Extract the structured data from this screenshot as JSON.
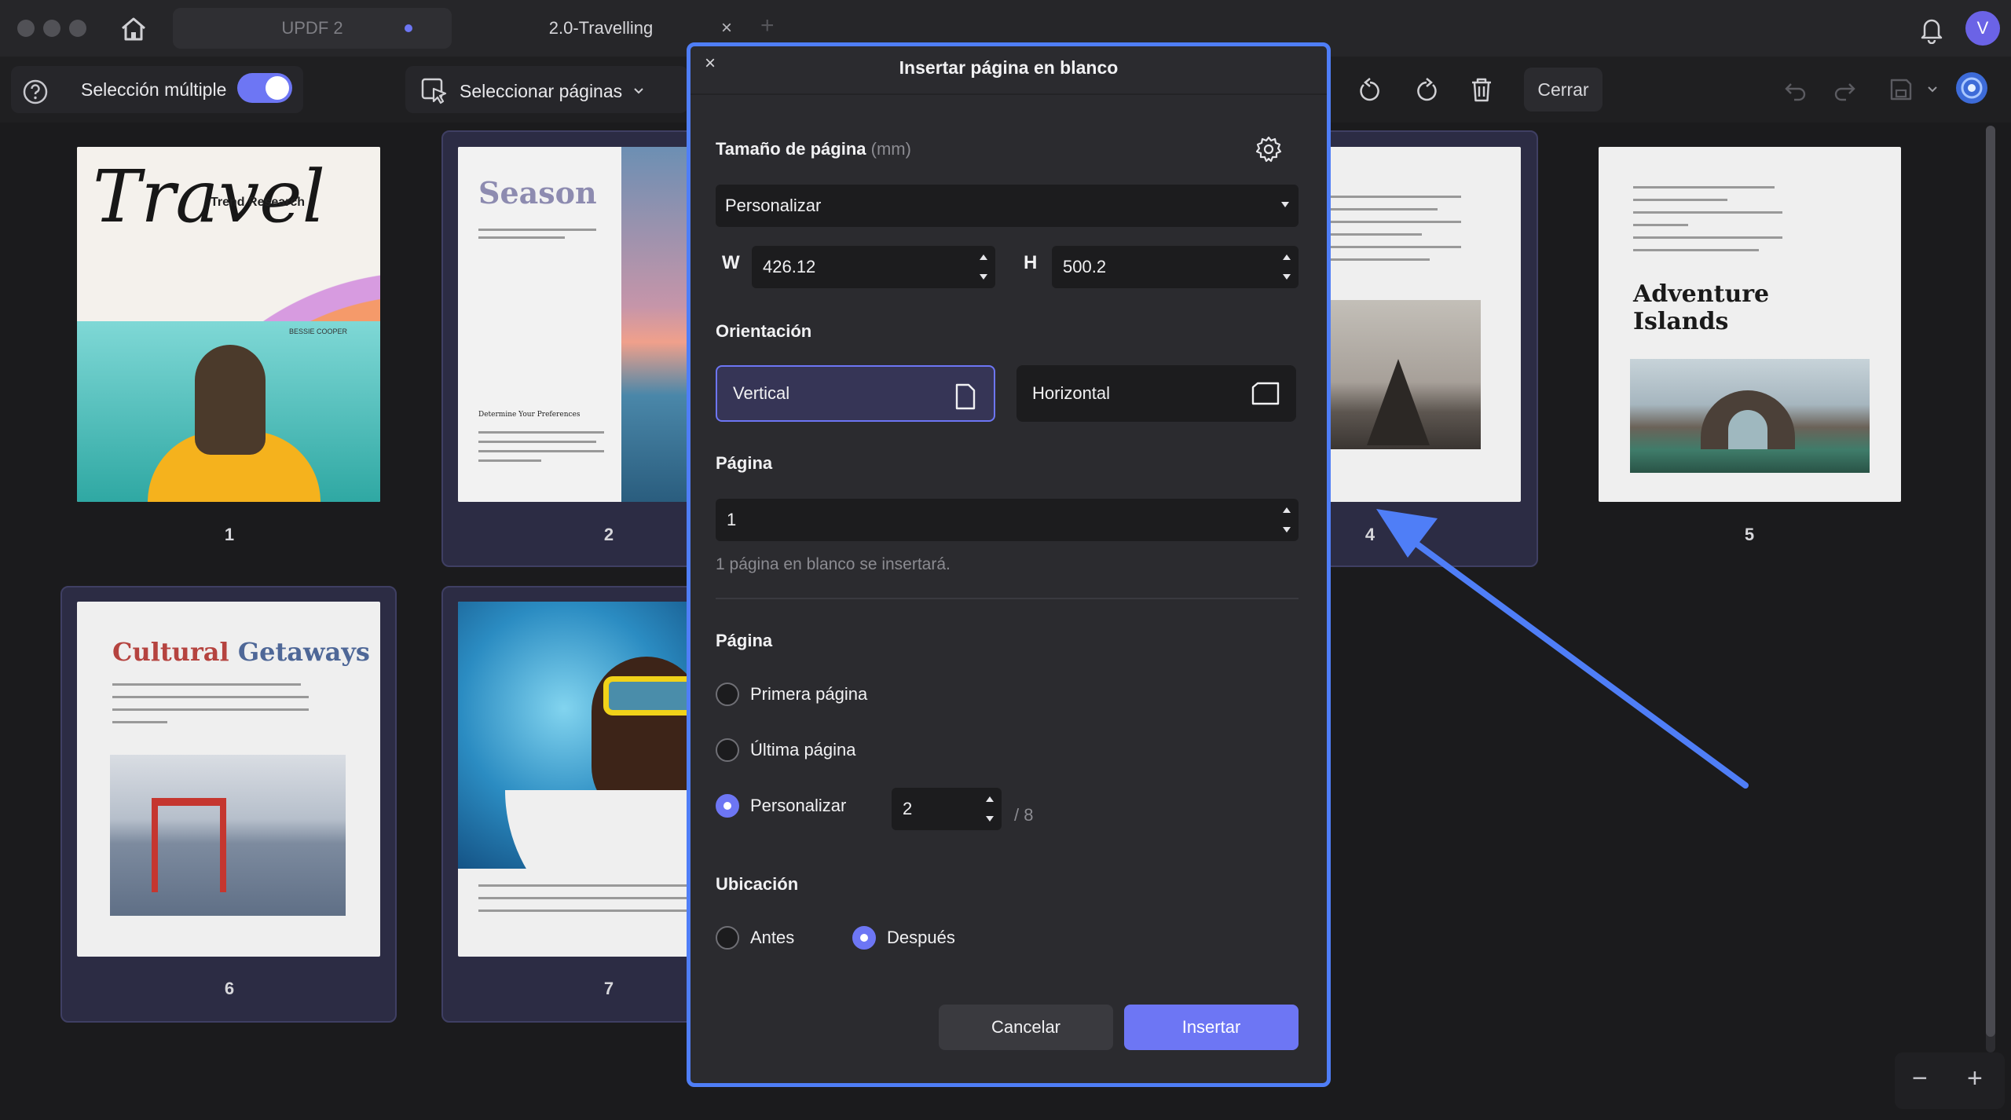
{
  "titlebar": {
    "tabs": [
      {
        "label": "UPDF 2"
      },
      {
        "label": "2.0-Travelling",
        "close": "×"
      }
    ],
    "add_tab": "+",
    "avatar_initial": "V"
  },
  "toolbar": {
    "multi_select_label": "Selección múltiple",
    "multi_select_on": true,
    "select_pages_label": "Seleccionar páginas",
    "close_label": "Cerrar"
  },
  "pages": [
    {
      "number": "1",
      "cover_title": "Travel",
      "cover_subtitle": "Trend Research",
      "author": "BESSIE COOPER"
    },
    {
      "number": "2",
      "cover_title": "Season",
      "heading": "Determine Your Preferences"
    },
    {
      "number": "4"
    },
    {
      "number": "5",
      "cover_title": "Adventure Islands"
    },
    {
      "number": "6",
      "cover_title_1": "Cultural",
      "cover_title_2": "Getaways"
    },
    {
      "number": "7"
    }
  ],
  "dialog": {
    "title": "Insertar página en blanco",
    "close": "×",
    "page_size_label": "Tamaño de página",
    "page_size_unit": "(mm)",
    "page_size_value": "Personalizar",
    "width_label": "W",
    "width_value": "426.12",
    "height_label": "H",
    "height_value": "500.2",
    "orientation_label": "Orientación",
    "orientation_vertical": "Vertical",
    "orientation_horizontal": "Horizontal",
    "orientation_selected": "Vertical",
    "count_label": "Página",
    "count_value": "1",
    "count_hint": "1 página en blanco se insertará.",
    "position_label": "Página",
    "position_options": [
      "Primera página",
      "Última página",
      "Personalizar"
    ],
    "position_selected": "Personalizar",
    "custom_page_value": "2",
    "total_pages": "/ 8",
    "location_label": "Ubicación",
    "location_options": [
      "Antes",
      "Después"
    ],
    "location_selected": "Después",
    "cancel_label": "Cancelar",
    "insert_label": "Insertar"
  },
  "zoom": {
    "minus": "−",
    "plus": "+"
  },
  "colors": {
    "accent": "#6d76f4",
    "dialog_border": "#4f7ef7",
    "arrow": "#4f7ef7"
  }
}
